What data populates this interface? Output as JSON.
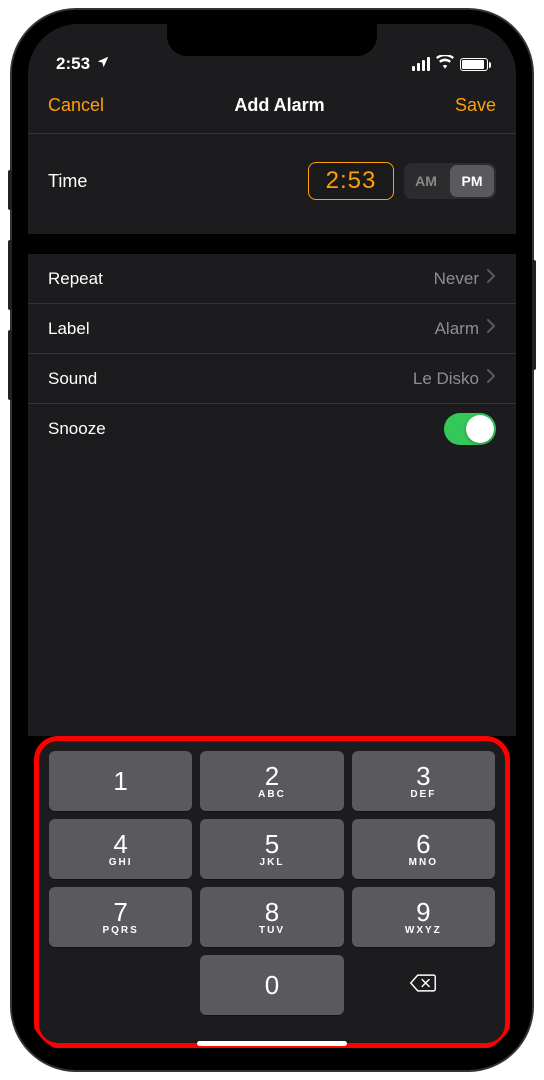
{
  "status": {
    "time": "2:53",
    "location_icon": "location-arrow"
  },
  "nav": {
    "cancel": "Cancel",
    "title": "Add Alarm",
    "save": "Save"
  },
  "time_section": {
    "label": "Time",
    "value": "2:53",
    "am": "AM",
    "pm": "PM",
    "selected": "PM"
  },
  "settings": {
    "repeat": {
      "label": "Repeat",
      "value": "Never"
    },
    "label_row": {
      "label": "Label",
      "value": "Alarm"
    },
    "sound": {
      "label": "Sound",
      "value": "Le Disko"
    },
    "snooze": {
      "label": "Snooze",
      "on": true
    }
  },
  "keypad": {
    "keys": [
      {
        "num": "1",
        "sub": ""
      },
      {
        "num": "2",
        "sub": "ABC"
      },
      {
        "num": "3",
        "sub": "DEF"
      },
      {
        "num": "4",
        "sub": "GHI"
      },
      {
        "num": "5",
        "sub": "JKL"
      },
      {
        "num": "6",
        "sub": "MNO"
      },
      {
        "num": "7",
        "sub": "PQRS"
      },
      {
        "num": "8",
        "sub": "TUV"
      },
      {
        "num": "9",
        "sub": "WXYZ"
      },
      {
        "num": "0",
        "sub": ""
      }
    ]
  },
  "colors": {
    "accent": "#ff9f0a",
    "highlight_border": "#ff0000"
  }
}
